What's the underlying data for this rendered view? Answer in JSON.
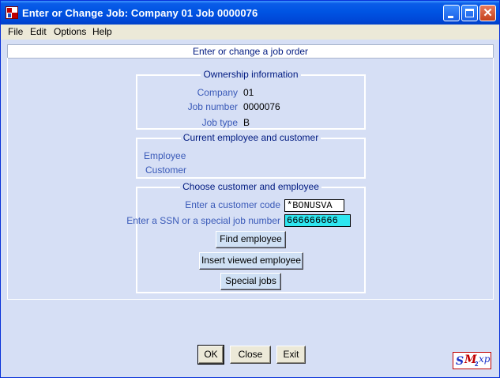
{
  "window": {
    "title": "Enter or Change Job:  Company 01 Job 0000076"
  },
  "menu": {
    "items": [
      {
        "label": "File"
      },
      {
        "label": "Edit"
      },
      {
        "label": "Options"
      },
      {
        "label": "Help"
      }
    ]
  },
  "header": {
    "subtitle": "Enter or change a job order"
  },
  "ownership": {
    "title": "Ownership information",
    "company_label": "Company",
    "company_value": "01",
    "job_number_label": "Job number",
    "job_number_value": "0000076",
    "job_type_label": "Job type",
    "job_type_value": "B"
  },
  "current": {
    "title": "Current employee and customer",
    "employee_label": "Employee",
    "customer_label": "Customer"
  },
  "choose": {
    "title": "Choose customer and employee",
    "customer_code_label": "Enter a customer code",
    "customer_code_value": "*BONUSVA",
    "ssn_label": "Enter a SSN or a special job number",
    "ssn_value": "666666666",
    "find_employee_label": "Find employee",
    "insert_viewed_label": "Insert viewed employee",
    "special_jobs_label": "Special jobs"
  },
  "footer": {
    "ok_label": "OK",
    "close_label": "Close",
    "exit_label": "Exit"
  },
  "logo": {
    "s": "S",
    "m": "M",
    "two": "2",
    "xp": "xp"
  },
  "colors": {
    "title_bar": "#0054e3",
    "background": "#d6dff5",
    "label_blue": "#3a5ab8",
    "ssn_highlight": "#2ee6f0"
  },
  "icons": {
    "app": "smxp-app-icon",
    "minimize": "minimize-icon",
    "maximize": "maximize-icon",
    "close": "close-icon"
  }
}
